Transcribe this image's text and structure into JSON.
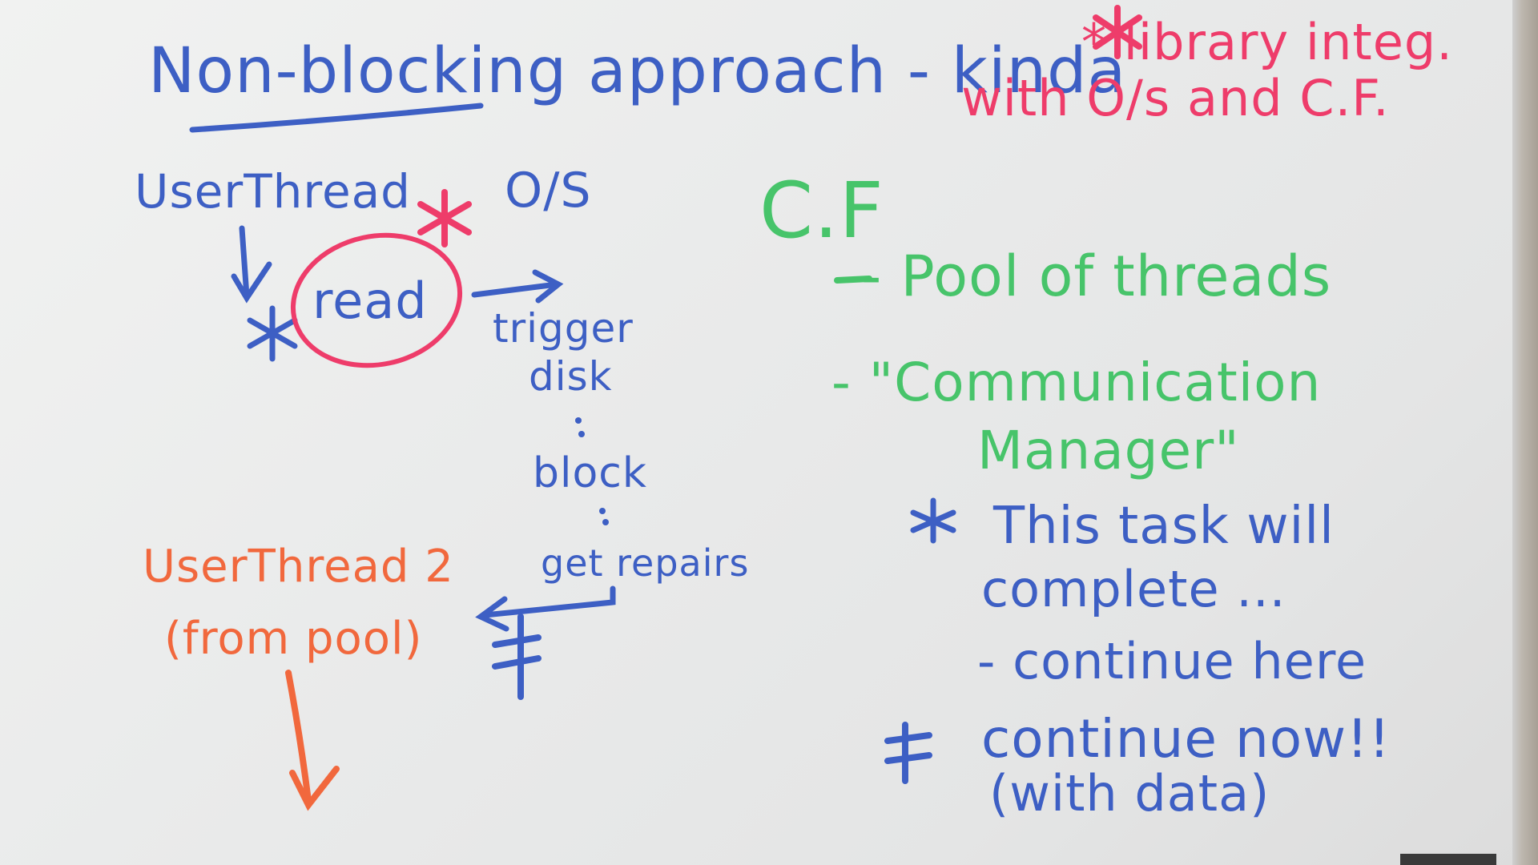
{
  "colors": {
    "blue": "#3d5fc4",
    "red": "#ee3c6a",
    "green": "#47c46a",
    "orange": "#f1683d"
  },
  "header": {
    "title": "Non-blocking approach - kinda",
    "note_line1": "* library integ.",
    "note_line2": "with O/s and C.F."
  },
  "left": {
    "user_thread": "UserThread",
    "os": "O/S",
    "read": "read",
    "trigger": "trigger",
    "disk": "disk",
    "block": "block",
    "get_repairs": "get repairs",
    "user_thread_2": "UserThread 2",
    "from_pool": "(from pool)"
  },
  "right": {
    "cf": "C.F",
    "pool": "- Pool of threads",
    "comm1": "- \"Communication",
    "comm2": "Manager\"",
    "task1": "This task will",
    "task2": "complete ...",
    "continue_here": "- continue here",
    "continue_now": "continue now!!",
    "with_data": "(with data)"
  }
}
